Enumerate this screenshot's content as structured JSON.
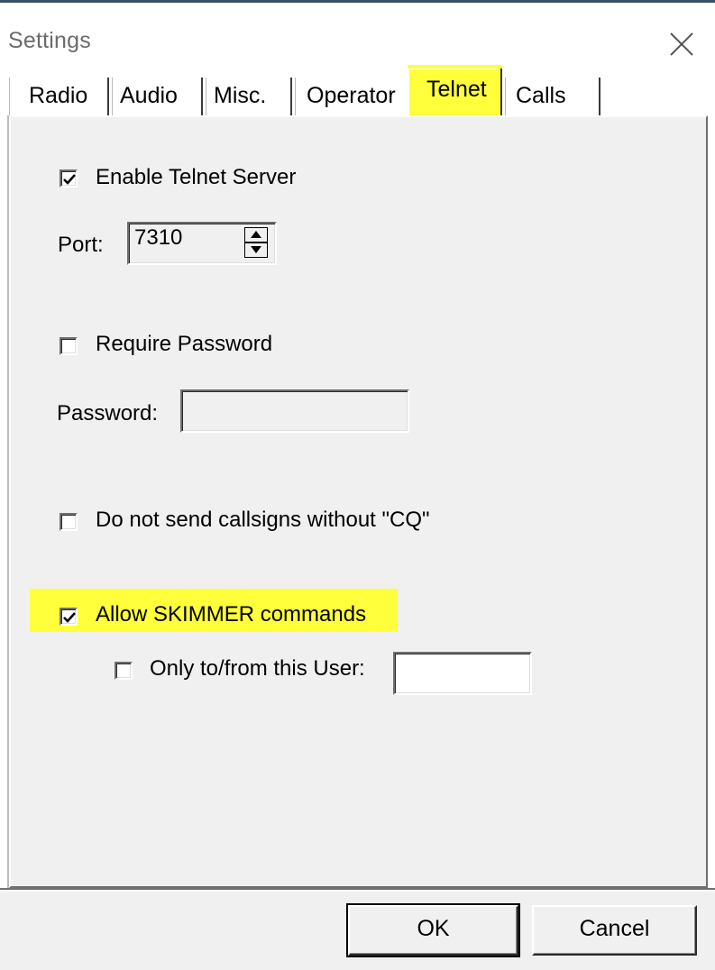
{
  "window": {
    "title": "Settings"
  },
  "tabs": [
    {
      "label": "Radio",
      "active": false
    },
    {
      "label": "Audio",
      "active": false
    },
    {
      "label": "Misc.",
      "active": false
    },
    {
      "label": "Operator",
      "active": false
    },
    {
      "label": "Telnet",
      "active": true
    },
    {
      "label": "Calls",
      "active": false
    }
  ],
  "telnet": {
    "enable_server": {
      "label": "Enable Telnet Server",
      "checked": true
    },
    "port": {
      "label": "Port:",
      "value": "7310"
    },
    "require_password": {
      "label": "Require Password",
      "checked": false
    },
    "password": {
      "label": "Password:",
      "value": ""
    },
    "no_callsigns": {
      "label": "Do not send callsigns without \"CQ\"",
      "checked": false
    },
    "allow_skimmer": {
      "label": "Allow SKIMMER commands",
      "checked": true
    },
    "only_user": {
      "label": "Only to/from this User:",
      "checked": false,
      "value": ""
    }
  },
  "footer": {
    "ok_label": "OK",
    "cancel_label": "Cancel"
  },
  "colors": {
    "highlight": "#ffff3c",
    "panel_bg": "#f0f0f0"
  },
  "icons": {
    "close": "close-icon",
    "checkmark": "checkmark-icon",
    "spin": "spin-updown-icon"
  }
}
